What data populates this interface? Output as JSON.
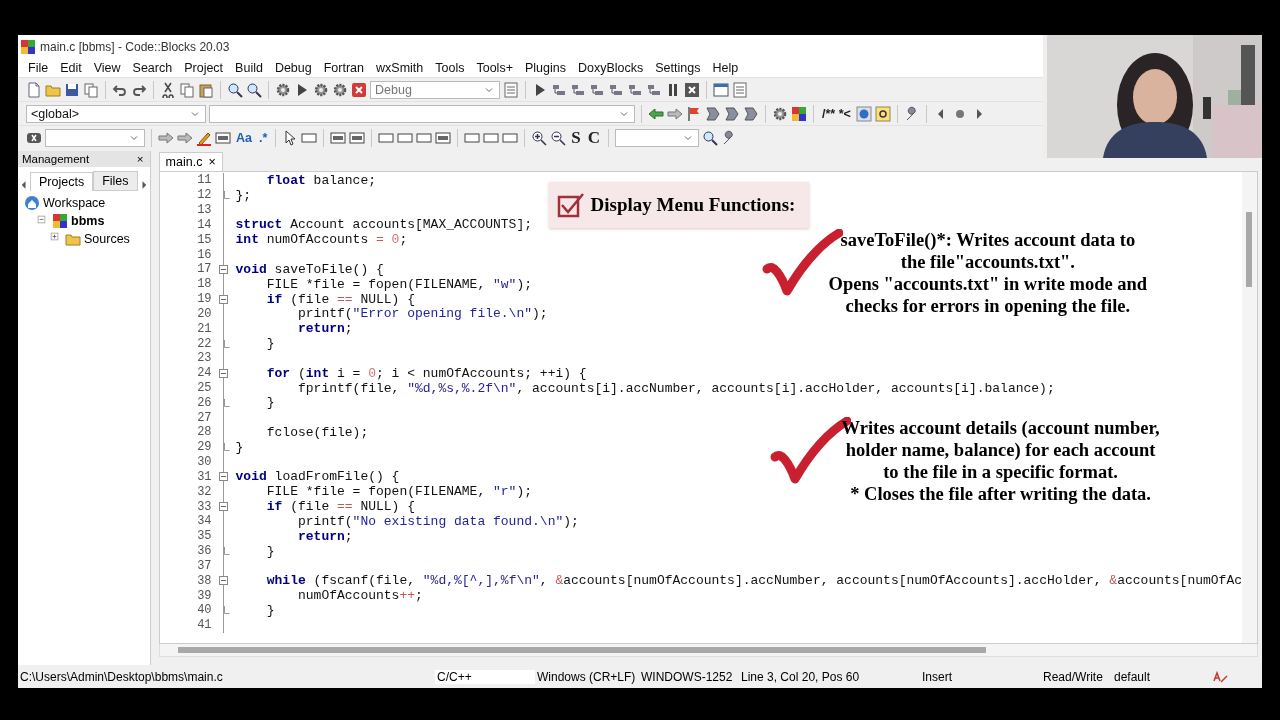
{
  "window": {
    "title": "main.c [bbms] - Code::Blocks 20.03"
  },
  "menu": [
    "File",
    "Edit",
    "View",
    "Search",
    "Project",
    "Build",
    "Debug",
    "Fortran",
    "wxSmith",
    "Tools",
    "Tools+",
    "Plugins",
    "DoxyBlocks",
    "Settings",
    "Help"
  ],
  "toolbars": {
    "build_target": "Debug",
    "scope": "<global>",
    "doxy_comment": "/** *<",
    "match_case": "Aa",
    "regex": ".*",
    "s_button": "S",
    "c_button": "C"
  },
  "management": {
    "title": "Management",
    "close": "×",
    "tabs": [
      {
        "label": "Projects",
        "selected": true
      },
      {
        "label": "Files",
        "selected": false
      }
    ],
    "tree": [
      {
        "label": "Workspace",
        "kind": "workspace",
        "children": [
          {
            "label": "bbms",
            "kind": "project",
            "children": [
              {
                "label": "Sources",
                "kind": "folder",
                "expanded": false
              }
            ]
          }
        ]
      }
    ]
  },
  "editor": {
    "tabs": [
      {
        "label": "main.c",
        "close": "×",
        "selected": true
      }
    ],
    "lines": [
      {
        "n": "11",
        "kind": "plain",
        "tokens": [
          {
            "text": "    float",
            "kind": "keyword"
          },
          {
            "text": " balance;",
            "kind": "plain"
          }
        ]
      },
      {
        "n": "12",
        "kind": "close",
        "tokens": [
          {
            "text": "};",
            "kind": "plain"
          }
        ]
      },
      {
        "n": "13",
        "kind": "plain"
      },
      {
        "n": "14",
        "kind": "plain",
        "tokens": [
          {
            "text": "struct",
            "kind": "keyword"
          },
          {
            "text": " Account accounts[MAX_ACCOUNTS];",
            "kind": "plain"
          }
        ]
      },
      {
        "n": "15",
        "kind": "plain",
        "tokens": [
          {
            "text": "int",
            "kind": "keyword"
          },
          {
            "text": " numOfAccounts ",
            "kind": "plain"
          },
          {
            "text": "= ",
            "kind": "operator"
          },
          {
            "text": "0",
            "kind": "number"
          },
          {
            "text": ";",
            "kind": "plain"
          }
        ]
      },
      {
        "n": "16",
        "kind": "plain"
      },
      {
        "n": "17",
        "kind": "open",
        "tokens": [
          {
            "text": "void",
            "kind": "keyword"
          },
          {
            "text": " saveToFile() {",
            "kind": "plain"
          }
        ]
      },
      {
        "n": "18",
        "kind": "plain",
        "tokens": [
          {
            "text": "    FILE *file = fopen(FILENAME, ",
            "kind": "plain"
          },
          {
            "text": "\"w\"",
            "kind": "string"
          },
          {
            "text": ");",
            "kind": "plain"
          }
        ]
      },
      {
        "n": "19",
        "kind": "open",
        "tokens": [
          {
            "text": "    if",
            "kind": "keyword"
          },
          {
            "text": " (file ",
            "kind": "plain"
          },
          {
            "text": "==",
            "kind": "operator"
          },
          {
            "text": " NULL) {",
            "kind": "plain"
          }
        ]
      },
      {
        "n": "20",
        "kind": "plain",
        "tokens": [
          {
            "text": "        printf(",
            "kind": "plain"
          },
          {
            "text": "\"Error opening file.\\n\"",
            "kind": "string"
          },
          {
            "text": ");",
            "kind": "plain"
          }
        ]
      },
      {
        "n": "21",
        "kind": "plain",
        "tokens": [
          {
            "text": "        return",
            "kind": "keyword"
          },
          {
            "text": ";",
            "kind": "plain"
          }
        ]
      },
      {
        "n": "22",
        "kind": "close",
        "tokens": [
          {
            "text": "    }",
            "kind": "plain"
          }
        ]
      },
      {
        "n": "23",
        "kind": "plain"
      },
      {
        "n": "24",
        "kind": "open",
        "tokens": [
          {
            "text": "    for",
            "kind": "keyword"
          },
          {
            "text": " (",
            "kind": "plain"
          },
          {
            "text": "int",
            "kind": "keyword"
          },
          {
            "text": " i = ",
            "kind": "plain"
          },
          {
            "text": "0",
            "kind": "number"
          },
          {
            "text": "; i < numOfAccounts; ++i) {",
            "kind": "plain"
          }
        ]
      },
      {
        "n": "25",
        "kind": "plain",
        "tokens": [
          {
            "text": "        fprintf(file, ",
            "kind": "plain"
          },
          {
            "text": "\"%d,%s,%.2f\\n\"",
            "kind": "string"
          },
          {
            "text": ", accounts[i].accNumber, accounts[i].accHolder, accounts[i].balance);",
            "kind": "plain"
          }
        ]
      },
      {
        "n": "26",
        "kind": "close",
        "tokens": [
          {
            "text": "    }",
            "kind": "plain"
          }
        ]
      },
      {
        "n": "27",
        "kind": "plain"
      },
      {
        "n": "28",
        "kind": "plain",
        "tokens": [
          {
            "text": "    fclose(file);",
            "kind": "plain"
          }
        ]
      },
      {
        "n": "29",
        "kind": "close",
        "tokens": [
          {
            "text": "}",
            "kind": "plain"
          }
        ]
      },
      {
        "n": "30",
        "kind": "plain"
      },
      {
        "n": "31",
        "kind": "open",
        "tokens": [
          {
            "text": "void",
            "kind": "keyword"
          },
          {
            "text": " loadFromFile() {",
            "kind": "plain"
          }
        ]
      },
      {
        "n": "32",
        "kind": "plain",
        "tokens": [
          {
            "text": "    FILE *file = fopen(FILENAME, ",
            "kind": "plain"
          },
          {
            "text": "\"r\"",
            "kind": "string"
          },
          {
            "text": ");",
            "kind": "plain"
          }
        ]
      },
      {
        "n": "33",
        "kind": "open",
        "tokens": [
          {
            "text": "    if",
            "kind": "keyword"
          },
          {
            "text": " (file ",
            "kind": "plain"
          },
          {
            "text": "==",
            "kind": "operator"
          },
          {
            "text": " NULL) {",
            "kind": "plain"
          }
        ]
      },
      {
        "n": "34",
        "kind": "plain",
        "tokens": [
          {
            "text": "        printf(",
            "kind": "plain"
          },
          {
            "text": "\"No existing data found.\\n\"",
            "kind": "string"
          },
          {
            "text": ");",
            "kind": "plain"
          }
        ]
      },
      {
        "n": "35",
        "kind": "plain",
        "tokens": [
          {
            "text": "        return",
            "kind": "keyword"
          },
          {
            "text": ";",
            "kind": "plain"
          }
        ]
      },
      {
        "n": "36",
        "kind": "close",
        "tokens": [
          {
            "text": "    }",
            "kind": "plain"
          }
        ]
      },
      {
        "n": "37",
        "kind": "plain"
      },
      {
        "n": "38",
        "kind": "open",
        "tokens": [
          {
            "text": "    while",
            "kind": "keyword"
          },
          {
            "text": " (fscanf(file, ",
            "kind": "plain"
          },
          {
            "text": "\"%d,%[^,],%f\\n\"",
            "kind": "string"
          },
          {
            "text": ", ",
            "kind": "plain"
          },
          {
            "text": "&",
            "kind": "operator"
          },
          {
            "text": "accounts[numOfAccounts].accNumber, accounts[numOfAccounts].accHolder, ",
            "kind": "plain"
          },
          {
            "text": "&",
            "kind": "operator"
          },
          {
            "text": "accounts[numOfAc",
            "kind": "plain"
          }
        ]
      },
      {
        "n": "39",
        "kind": "plain",
        "tokens": [
          {
            "text": "        numOfAccounts",
            "kind": "plain"
          },
          {
            "text": "++",
            "kind": "operator"
          },
          {
            "text": ";",
            "kind": "plain"
          }
        ]
      },
      {
        "n": "40",
        "kind": "close",
        "tokens": [
          {
            "text": "    }",
            "kind": "plain"
          }
        ]
      },
      {
        "n": "41",
        "kind": "plain"
      }
    ]
  },
  "annotations": {
    "heading": "Display Menu Functions:",
    "notes": [
      {
        "lines": [
          "saveToFile()*: Writes account data to",
          "the file\"accounts.txt\".",
          "Opens \"accounts.txt\" in write mode and",
          "checks for errors in opening the file."
        ]
      },
      {
        "lines": [
          "Writes account details (account number,",
          "holder name, balance) for each account",
          "to the file in a specific format.",
          "*   Closes the file after writing the data."
        ]
      }
    ]
  },
  "status_bar": [
    "C:\\Users\\Admin\\Desktop\\bbms\\main.c",
    "C/C++",
    "Windows (CR+LF)",
    "WINDOWS-1252",
    "Line 3, Col 20, Pos 60",
    "Insert",
    "Read/Write",
    "default"
  ]
}
